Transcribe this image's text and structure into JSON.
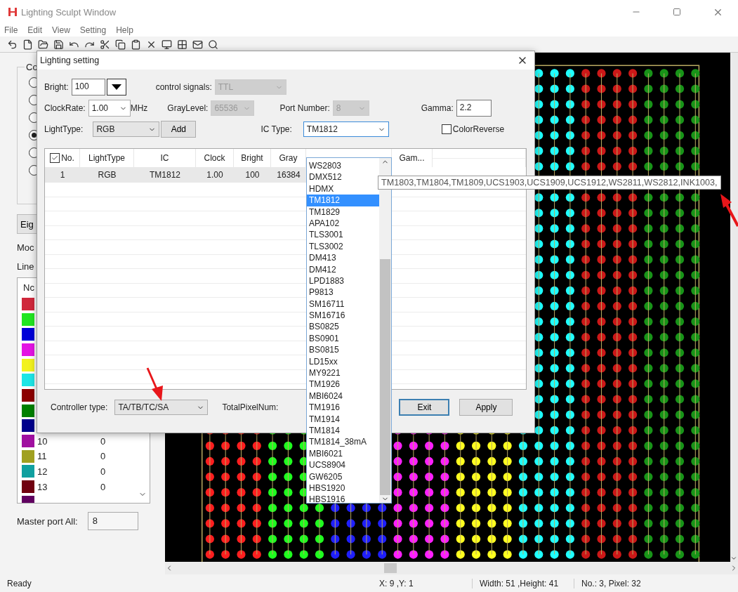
{
  "window": {
    "title": "Lighting Sculpt Window"
  },
  "menu": [
    "File",
    "Edit",
    "View",
    "Setting",
    "Help"
  ],
  "left_panel": {
    "group_label": "Co",
    "radios": [
      {
        "selected": false
      },
      {
        "selected": false
      },
      {
        "selected": false
      },
      {
        "selected": true
      },
      {
        "selected": false
      },
      {
        "selected": false
      }
    ],
    "button": "Eig",
    "labels": [
      "Moc",
      "Line"
    ],
    "list": {
      "header": "Nc",
      "rows": [
        {
          "color": "#d0283c"
        },
        {
          "color": "#22e622"
        },
        {
          "color": "#0000d8"
        },
        {
          "color": "#e414e4"
        },
        {
          "color": "#f2f21e"
        },
        {
          "color": "#1ee6e6"
        },
        {
          "color": "#8c0000"
        },
        {
          "color": "#008000"
        },
        {
          "color": "#00008c"
        },
        {
          "color": "#a010a0",
          "number": "10",
          "value": "0"
        },
        {
          "color": "#a0a020",
          "number": "11",
          "value": "0"
        },
        {
          "color": "#10a0a0",
          "number": "12",
          "value": "0"
        },
        {
          "color": "#700010",
          "number": "13",
          "value": "0"
        },
        {
          "color": "#600060"
        }
      ]
    },
    "master_port": {
      "label": "Master port All:",
      "value": "8"
    }
  },
  "dialog": {
    "title": "Lighting setting",
    "bright": {
      "label": "Bright:",
      "value": "100"
    },
    "control_signals": {
      "label": "control signals:",
      "value": "TTL",
      "disabled": true
    },
    "clock_rate": {
      "label": "ClockRate:",
      "value": "1.00",
      "unit": "MHz"
    },
    "gray_level": {
      "label": "GrayLevel:",
      "value": "65536",
      "disabled": true
    },
    "port_number": {
      "label": "Port Number:",
      "value": "8",
      "disabled": true
    },
    "gamma": {
      "label": "Gamma:",
      "value": "2.2"
    },
    "light_type": {
      "label": "LightType:",
      "value": "RGB"
    },
    "add_button": "Add",
    "ic_type": {
      "label": "IC Type:",
      "value": "TM1812",
      "expanded": true,
      "options": [
        {
          "label": "WS2803",
          "selected": false
        },
        {
          "label": "DMX512",
          "selected": false
        },
        {
          "label": "HDMX",
          "selected": false
        },
        {
          "label": "TM1812",
          "selected": true
        },
        {
          "label": "TM1829",
          "selected": false
        },
        {
          "label": "APA102",
          "selected": false
        },
        {
          "label": "TLS3001",
          "selected": false
        },
        {
          "label": "TLS3002",
          "selected": false
        },
        {
          "label": "DM413",
          "selected": false
        },
        {
          "label": "DM412",
          "selected": false
        },
        {
          "label": "LPD1883",
          "selected": false
        },
        {
          "label": "P9813",
          "selected": false
        },
        {
          "label": "SM16711",
          "selected": false
        },
        {
          "label": "SM16716",
          "selected": false
        },
        {
          "label": "BS0825",
          "selected": false
        },
        {
          "label": "BS0901",
          "selected": false
        },
        {
          "label": "BS0815",
          "selected": false
        },
        {
          "label": "LD15xx",
          "selected": false
        },
        {
          "label": "MY9221",
          "selected": false
        },
        {
          "label": "TM1926",
          "selected": false
        },
        {
          "label": "MBI6024",
          "selected": false
        },
        {
          "label": "TM1916",
          "selected": false
        },
        {
          "label": "TM1914",
          "selected": false
        },
        {
          "label": "TM1814",
          "selected": false
        },
        {
          "label": "TM1814_38mA",
          "selected": false
        },
        {
          "label": "MBI6021",
          "selected": false
        },
        {
          "label": "UCS8904",
          "selected": false
        },
        {
          "label": "GW6205",
          "selected": false
        },
        {
          "label": "HBS1920",
          "selected": false
        },
        {
          "label": "HBS1916",
          "selected": false
        }
      ]
    },
    "color_reverse": {
      "label": "ColorReverse",
      "checked": false
    },
    "table": {
      "header_checked": true,
      "columns": [
        "No.",
        "LightType",
        "IC",
        "Clock",
        "Bright",
        "Gray",
        "Gam..."
      ],
      "rows": [
        {
          "selected": true,
          "cells": [
            "1",
            "RGB",
            "TM1812",
            "1.00",
            "100",
            "16384"
          ]
        }
      ]
    },
    "controller_type": {
      "label": "Controller type:",
      "value": "TA/TB/TC/SA"
    },
    "total_pixel_num": {
      "label": "TotalPixelNum:"
    },
    "buttons": [
      {
        "label": "Exit",
        "focused": true
      },
      {
        "label": "Apply",
        "focused": false
      }
    ]
  },
  "tooltip": "TM1803,TM1804,TM1809,UCS1903,UCS1909,UCS1912,WS2811,WS2812,INK1003,",
  "status_bar": [
    "Ready",
    "X: 9 ,Y: 1",
    "Width: 51 ,Height: 41",
    "No.: 3, Pixel: 32"
  ]
}
